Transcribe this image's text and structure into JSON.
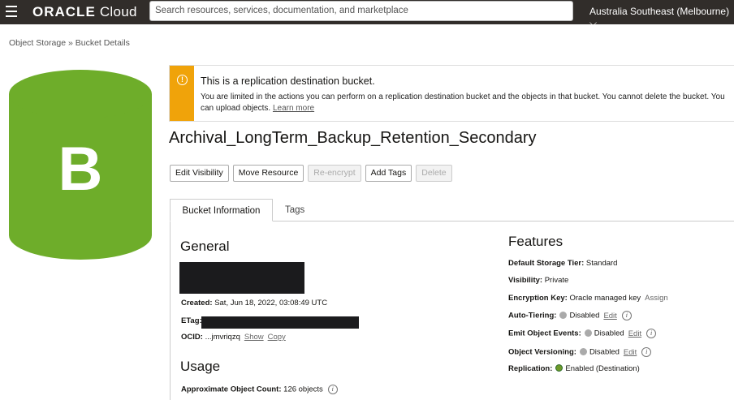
{
  "topbar": {
    "logo_brand": "ORACLE",
    "logo_product": "Cloud",
    "search_placeholder": "Search resources, services, documentation, and marketplace",
    "region": "Australia Southeast (Melbourne)"
  },
  "breadcrumb": {
    "root": "Object Storage",
    "sep": "»",
    "current": "Bucket Details"
  },
  "bucket_icon": {
    "letter": "B",
    "color": "#6ead2a"
  },
  "banner": {
    "title": "This is a replication destination bucket.",
    "text": "You are limited in the actions you can perform on a replication destination bucket and the objects in that bucket. You cannot delete the bucket. You can upload objects.",
    "link": "Learn more",
    "accent": "#f0a30a"
  },
  "bucket_name": "Archival_LongTerm_Backup_Retention_Secondary",
  "actions": {
    "edit_visibility": "Edit Visibility",
    "move_resource": "Move Resource",
    "re_encrypt": "Re-encrypt",
    "add_tags": "Add Tags",
    "delete": "Delete"
  },
  "tabs": {
    "bucket_information": "Bucket Information",
    "tags": "Tags"
  },
  "general": {
    "heading": "General",
    "created_label": "Created:",
    "created_value": "Sat, Jun 18, 2022, 03:08:49 UTC",
    "etag_label": "ETag:",
    "ocid_label": "OCID:",
    "ocid_value": "...jmvriqzq",
    "show": "Show",
    "copy": "Copy"
  },
  "usage": {
    "heading": "Usage",
    "count_label": "Approximate Object Count:",
    "count_value": "126 objects"
  },
  "features": {
    "heading": "Features",
    "storage_tier_label": "Default Storage Tier:",
    "storage_tier_value": "Standard",
    "visibility_label": "Visibility:",
    "visibility_value": "Private",
    "encryption_label": "Encryption Key:",
    "encryption_value": "Oracle managed key",
    "assign": "Assign",
    "auto_tiering_label": "Auto-Tiering:",
    "auto_tiering_value": "Disabled",
    "emit_events_label": "Emit Object Events:",
    "emit_events_value": "Disabled",
    "versioning_label": "Object Versioning:",
    "versioning_value": "Disabled",
    "replication_label": "Replication:",
    "replication_value": "Enabled (Destination)",
    "edit": "Edit",
    "info_glyph": "i"
  }
}
